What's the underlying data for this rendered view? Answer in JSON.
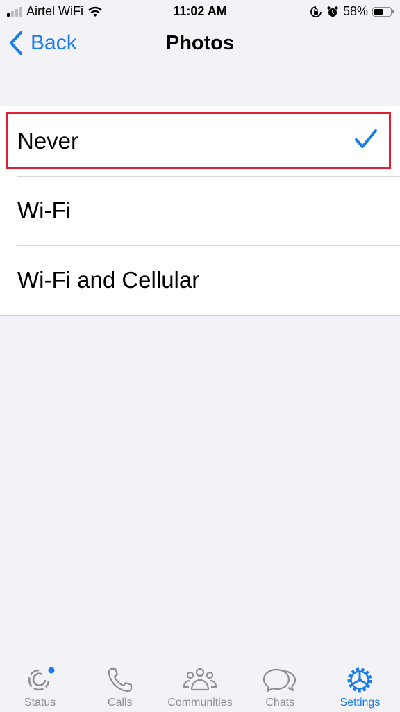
{
  "status_bar": {
    "carrier": "Airtel WiFi",
    "time": "11:02 AM",
    "battery_percent_label": "58%",
    "battery_level": 0.58
  },
  "nav": {
    "back_label": "Back",
    "title": "Photos"
  },
  "options": [
    {
      "label": "Never",
      "selected": true
    },
    {
      "label": "Wi-Fi",
      "selected": false
    },
    {
      "label": "Wi-Fi and Cellular",
      "selected": false
    }
  ],
  "tabs": [
    {
      "label": "Status",
      "icon": "status-icon",
      "active": false,
      "badge": true
    },
    {
      "label": "Calls",
      "icon": "phone-icon",
      "active": false
    },
    {
      "label": "Communities",
      "icon": "communities-icon",
      "active": false
    },
    {
      "label": "Chats",
      "icon": "chats-icon",
      "active": false
    },
    {
      "label": "Settings",
      "icon": "gear-icon",
      "active": true
    }
  ],
  "colors": {
    "accent": "#1a7ce8",
    "highlight_border": "#e02030",
    "inactive_tab": "#8e8e93"
  }
}
